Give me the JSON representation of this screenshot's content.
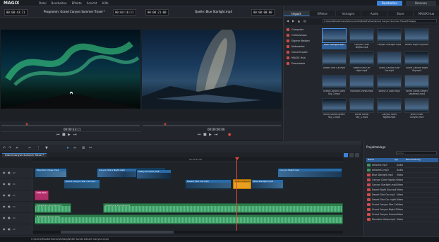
{
  "app": {
    "logo": "MAGIX",
    "menu": [
      "Datei",
      "Bearbeiten",
      "Effekte",
      "Ansicht",
      "Hilfe"
    ],
    "buttons": [
      "Bearbeiten",
      "Brennen"
    ]
  },
  "program_monitor": {
    "timecode_left": "00:00:43:21",
    "title": "Programm: Grand Canyon Summer Travel *",
    "timecode_right": "00:04:16:11",
    "position": "00:00:33:11"
  },
  "source_monitor": {
    "timecode_left": "00:00:21:00",
    "title": "Quelle: Blue Starlight.mp4",
    "timecode_right": "00:00:00:00",
    "position": "00:00:00:00"
  },
  "browser": {
    "tabs": [
      "Import",
      "Effekte",
      "Vorlagen",
      "Audio",
      "Store",
      "MAGIX Hub"
    ],
    "path": "C:\\Users\\MustermanA\\Documents\\MAGIX\\Video\\Grand Canyon Summer Travel\\Footage",
    "nav": [
      "Computer",
      "Onlineshops",
      "Eigene Medien",
      "Netzwerke",
      "Cloud Import",
      "MAGIX Hub",
      "Downloads"
    ],
    "thumbs": [
      {
        "label": "Blue Starlight.mp4",
        "selected": true
      },
      {
        "label": "Canyon Clear Nights.mp4",
        "selected": false
      },
      {
        "label": "Canyon Starlight.mp4",
        "selected": false
      },
      {
        "label": "Desert Night Sky.mp4",
        "selected": false
      },
      {
        "label": "Desert Star Car.mp4",
        "selected": false
      },
      {
        "label": "Desert Star Car night.mp4",
        "selected": false
      },
      {
        "label": "Grand Canyon Star Car.mp4",
        "selected": false
      },
      {
        "label": "Grand Canyon Night Sky.mp4",
        "selected": false
      },
      {
        "label": "Grand Canyon Stars Sky_3.mp4",
        "selected": false
      },
      {
        "label": "Mountain Views.mp4",
        "selected": false
      },
      {
        "label": "Valley Of Gods.mp4",
        "selected": false
      },
      {
        "label": "White Sands Desert Landmark.mp4",
        "selected": false
      },
      {
        "label": "White Sands Desert Sky_1.mp4",
        "selected": false
      },
      {
        "label": "White Sands Sky_1.mp4",
        "selected": false
      },
      {
        "label": "Canyon Stars Nights.mp4",
        "selected": false
      },
      {
        "label": "White River Canyon.mp4",
        "selected": false
      }
    ]
  },
  "timeline": {
    "tab": "Grand Canyon Summer Travel *",
    "ruler": "00:00:25:00",
    "clips": [
      {
        "label": "Mountain Views.mp4"
      },
      {
        "label": "Grand Canyon Star Car.mp4"
      },
      {
        "label": "Canyon Stars Night.mp4"
      },
      {
        "label": "Valley Of Gods.mp4"
      },
      {
        "label": "Desert Star Car.mp4"
      },
      {
        "label": "Grand Canyon Stars.mp4"
      },
      {
        "label": "Blue Starlight.mp4"
      },
      {
        "label": "Canyon Night.mp4"
      },
      {
        "label": "Title Text"
      }
    ],
    "audio": [
      {
        "label": "Adventure Sounds.mp3"
      },
      {
        "label": "Adventure Sounds.mp3"
      },
      {
        "label": "Travelling Sound.mp3"
      }
    ]
  },
  "project": {
    "title": "Projektablage",
    "search_placeholder": "Suchen...",
    "columns": [
      "Name",
      "Typ",
      "Beschreibung"
    ],
    "rows": [
      {
        "name": "Ambient.mp3",
        "type": "Audio"
      },
      {
        "name": "Ambient2.mp3",
        "type": "Audio"
      },
      {
        "name": "Blue Starlight.mp4",
        "type": "Video"
      },
      {
        "name": "Canyon Clear Nights.mp4",
        "type": "Video"
      },
      {
        "name": "Canyon Starlight.mp4",
        "type": "Video"
      },
      {
        "name": "Desert Night Sky.mp4",
        "type": "Video"
      },
      {
        "name": "Desert Star Car.mp4",
        "type": "Video"
      },
      {
        "name": "Desert Star Car night.mp4",
        "type": "Video"
      },
      {
        "name": "Grand Canyon Star Car.mp4",
        "type": "Video"
      },
      {
        "name": "Grand Canyon Night Sky.mp4",
        "type": "Video"
      },
      {
        "name": "Grand Canyon Summer Travel",
        "type": "Video"
      },
      {
        "name": "Mountain Views.mp4",
        "type": "Video"
      }
    ]
  },
  "status": {
    "path": "C:\\Users\\MustermanA\\Videos\\White Sands Desert Canyon.mp4"
  }
}
